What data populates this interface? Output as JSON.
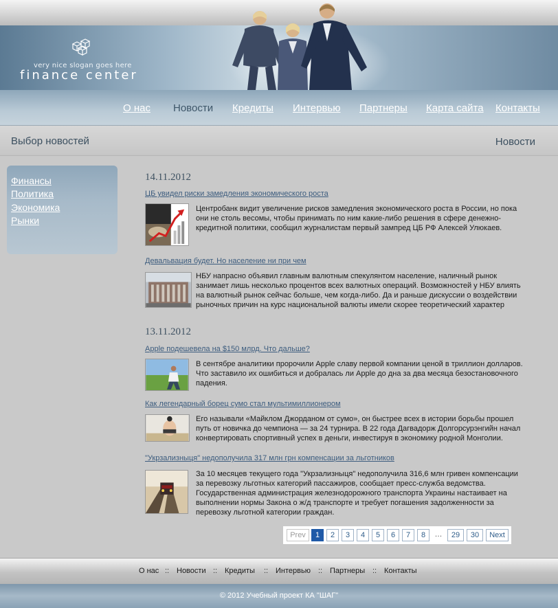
{
  "header": {
    "slogan": "very nice slogan goes here",
    "brand": "finance center"
  },
  "nav": {
    "items": [
      {
        "label": "О нас",
        "active": false
      },
      {
        "label": "Новости",
        "active": true
      },
      {
        "label": "Кредиты",
        "active": false
      },
      {
        "label": "Интервью",
        "active": false
      },
      {
        "label": "Партнеры",
        "active": false
      },
      {
        "label": "Карта сайта",
        "active": false
      },
      {
        "label": "Контакты",
        "active": false
      }
    ]
  },
  "subheader": {
    "title": "Выбор новостей",
    "section": "Новости"
  },
  "sidebar": {
    "items": [
      "Финансы",
      "Политика",
      "Экономика",
      "Рынки"
    ]
  },
  "news": {
    "groups": [
      {
        "date": "14.11.2012",
        "items": [
          {
            "title": "ЦБ увидел риски замедления экономического роста",
            "text": "Центробанк видит увеличение рисков замедления экономического роста в России, но пока они не столь весомы, чтобы принимать по ним какие-либо решения в сфере денежно-кредитной политики, сообщил журналистам первый зампред ЦБ РФ Алексей Улюкаев."
          },
          {
            "title": "Девальвация будет. Но население ни при чем",
            "text": "НБУ напрасно объявил главным валютным спекулянтом население, наличный рынок занимает лишь несколько процентов всех валютных операций. Возможностей у НБУ влиять на валютный рынок сейчас больше, чем когда-либо. Да и раньше дискуссии о воздействии рыночных причин на курс национальной валюты имели скорее теоретический характер"
          }
        ]
      },
      {
        "date": "13.11.2012",
        "items": [
          {
            "title": "Apple подешевела на $150 млрд. Что дальше?",
            "text": "В сентябре аналитики пророчили Apple славу первой компании ценой в триллион долларов. Что заставило их ошибиться и добралась ли Apple до дна за два месяца безостановочного падения."
          },
          {
            "title": "Как легендарный борец сумо стал мультимиллионером",
            "text": "Его называли «Майклом Джорданом от сумо», он быстрее всех в истории борьбы прошел путь от новичка до чемпиона — за 24 турнира. В 22 года Дагвадорж Долгорсурэнгийн начал конвертировать спортивный успех в деньги, инвестируя в экономику родной Монголии."
          },
          {
            "title": "\"Укрзализныця\" недополучила 317 млн грн компенсации за льготников",
            "text": "За 10 месяцев текущего года \"Укрзализныця\" недополучила 316,6 млн гривен компенсации за перевозку льготных категорий пассажиров, сообщает пресс-служба ведомства. Государственная администрация железнодорожного транспорта Украины настаивает на выполнении нормы Закона о ж/д транспорте и требует погашения задолженности за перевозку льготной категории граждан."
          }
        ]
      }
    ]
  },
  "pagination": {
    "prev": "Prev",
    "pages": [
      "1",
      "2",
      "3",
      "4",
      "5",
      "6",
      "7",
      "8"
    ],
    "ellipsis": "…",
    "last_pages": [
      "29",
      "30"
    ],
    "next": "Next",
    "current": "1"
  },
  "footer": {
    "links": [
      "О нас",
      "Новости",
      "Кредиты",
      "Интервью",
      "Партнеры",
      "Контакты"
    ],
    "separator": "::",
    "copyright": "© 2012 Учебный проект КА \"ШАГ\""
  },
  "colors": {
    "accent": "#1f5aa8",
    "link": "#3c5c7e",
    "nav_active": "#3e5669"
  }
}
